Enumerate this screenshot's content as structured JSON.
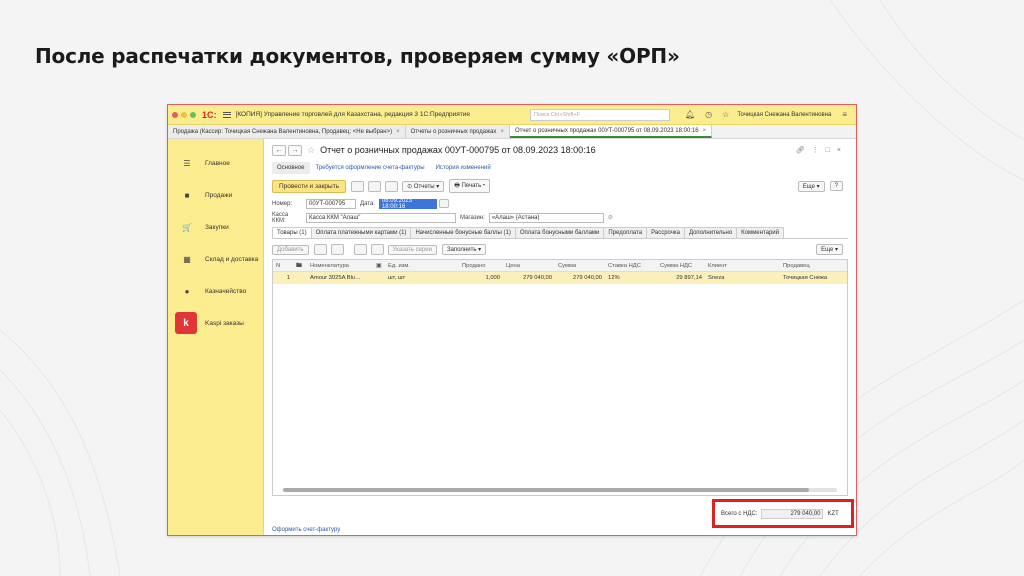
{
  "slide": {
    "title": "После распечатки документов, проверяем сумму «ОРП»"
  },
  "window": {
    "app_title": "[КОПИЯ] Управление торговлей для Казахстана, редакция 3 1С:Предприятие",
    "search_placeholder": "Поиск Ctrl+Shift+F",
    "user_name": "Точицкая Снежана Валентиновна",
    "logo": "1С:"
  },
  "tabs": [
    {
      "label": "Продажа (Кассир: Точицкая Снежана Валентиновна, Продавец: <Не выбран>)",
      "close": "×"
    },
    {
      "label": "Отчеты о розничных продажах",
      "close": "×"
    },
    {
      "label": "Отчет о розничных продажах 00УТ-000795 от 08.09.2023 18:00:16",
      "close": "×"
    }
  ],
  "sidebar": {
    "items": [
      {
        "label": "Главное",
        "icon": "menu-icon",
        "glyph": "☰"
      },
      {
        "label": "Продажи",
        "icon": "bag-icon",
        "glyph": "■"
      },
      {
        "label": "Закупки",
        "icon": "cart-icon",
        "glyph": "🛒"
      },
      {
        "label": "Склад и доставка",
        "icon": "warehouse-icon",
        "glyph": "▦"
      },
      {
        "label": "Казначейство",
        "icon": "coins-icon",
        "glyph": "●"
      },
      {
        "label": "Kaspi заказы",
        "icon": "kaspi-logo-icon",
        "glyph": "k"
      }
    ]
  },
  "document": {
    "title": "Отчет о розничных продажах 00УТ-000795 от 08.09.2023 18:00:16",
    "nav_back": "←",
    "nav_fwd": "→",
    "star": "☆",
    "links": {
      "main": "Основное",
      "invoice_required": "Требуется оформление счета-фактуры",
      "history": "История изменений"
    },
    "toolbar": {
      "post_close": "Провести и закрыть",
      "reports": "Отчеты",
      "print": "Печать",
      "more": "Еще",
      "help": "?"
    },
    "fields": {
      "number_label": "Номер:",
      "number": "00УТ-000795",
      "date_label": "Дата:",
      "date": "08.09.2023 18:00:16",
      "kkm_label": "Касса ККМ:",
      "kkm": "Касса ККМ \"Алаш\"",
      "store_label": "Магазин:",
      "store": "«Алаш» (Астана)"
    },
    "subtabs": [
      "Товары (1)",
      "Оплата платежными картами (1)",
      "Начисленные бонусные баллы (1)",
      "Оплата бонусными баллами",
      "Предоплата",
      "Рассрочка",
      "Дополнительно",
      "Комментарий"
    ],
    "table_toolbar": {
      "add": "Добавить",
      "serials": "Указать серии",
      "fill": "Заполнить",
      "more": "Еще"
    },
    "columns": [
      "N",
      "",
      "Номенклатура",
      "",
      "Ед. изм.",
      "Продано",
      "Цена",
      "Сумма",
      "Ставка НДС",
      "Сумма НДС",
      "Клиент",
      "Продавец"
    ],
    "rows": [
      [
        "1",
        "",
        "Amour 3025A Blu…",
        "",
        "шт, шт",
        "1,000",
        "279 040,00",
        "279 040,00",
        "12%",
        "29 897,14",
        "Sneza",
        "Точицкая Снежа"
      ]
    ],
    "total": {
      "label": "Всего с НДС:",
      "value": "279 040,00",
      "currency": "KZT"
    },
    "footer_link": "Оформить счет-фактуру"
  }
}
